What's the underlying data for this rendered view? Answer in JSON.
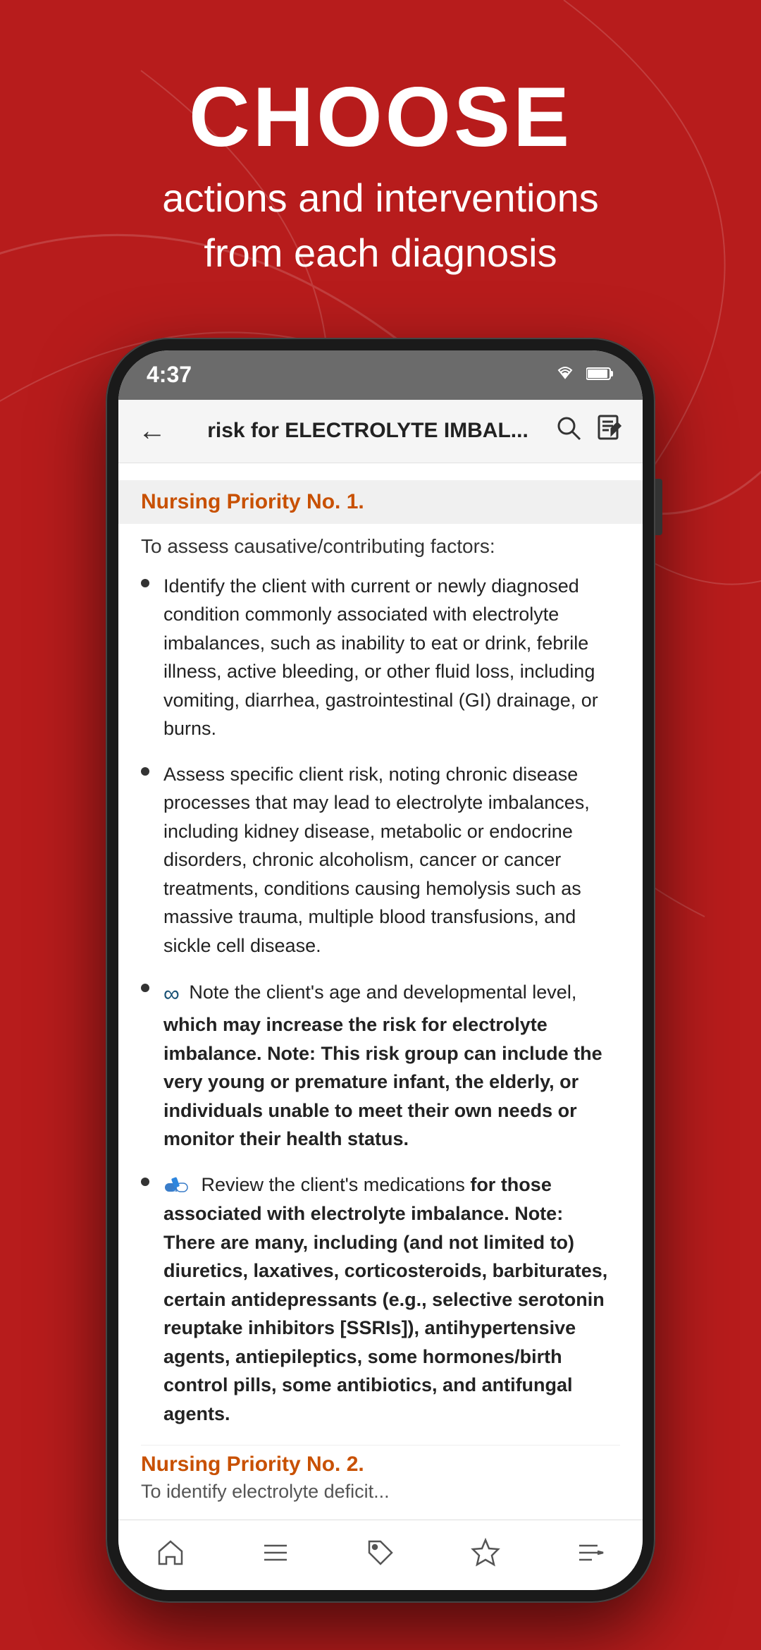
{
  "background": {
    "color": "#b71c1c"
  },
  "hero": {
    "title": "CHOOSE",
    "subtitle_line1": "actions and interventions",
    "subtitle_line2": "from each diagnosis"
  },
  "status_bar": {
    "time": "4:37",
    "wifi_icon": "wifi",
    "battery_icon": "battery"
  },
  "app_header": {
    "back_icon": "←",
    "title": "risk for ELECTROLYTE IMBAL...",
    "search_icon": "search",
    "notes_icon": "notes"
  },
  "content": {
    "priority_1": {
      "label": "Nursing Priority No. 1.",
      "subtitle": "To assess causative/contributing factors:",
      "bullets": [
        {
          "icon": null,
          "text": "Identify the client with current or newly diagnosed condition commonly associated with electrolyte imbalances, such as inability to eat or drink, febrile illness, active bleeding, or other fluid loss, including vomiting, diarrhea, gastrointestinal (GI) drainage, or burns."
        },
        {
          "icon": null,
          "text": "Assess specific client risk, noting chronic disease processes that may lead to electrolyte imbalances, including kidney disease, metabolic or endocrine disorders, chronic alcoholism, cancer or cancer treatments, conditions causing hemolysis such as massive trauma, multiple blood transfusions, and sickle cell disease."
        },
        {
          "icon": "∞",
          "text_plain": "Note the client's age and developmental level, ",
          "text_bold": "which may increase the risk for electrolyte imbalance. Note: This risk group can include the very young or premature infant, the elderly, or individuals unable to meet their own needs or monitor their health status."
        },
        {
          "icon": "💊",
          "text_plain": "Review the client's medications ",
          "text_bold": "for those associated with electrolyte imbalance. Note: There are many, including (and not limited to) diuretics, laxatives, corticosteroids, barbiturates, certain antidepressants (e.g., selective serotonin reuptake inhibitors [SSRIs]), antihypertensive agents, antiepileptics, some hormones/birth control pills, some antibiotics, and antifungal agents."
        }
      ]
    },
    "priority_2": {
      "label": "Nursing Priority No. 2.",
      "subtitle": "To identify electrolyte deficit..."
    }
  },
  "bottom_nav": {
    "home_icon": "home",
    "list_icon": "list",
    "tag_icon": "tag",
    "star_icon": "star",
    "menu_icon": "menu"
  }
}
